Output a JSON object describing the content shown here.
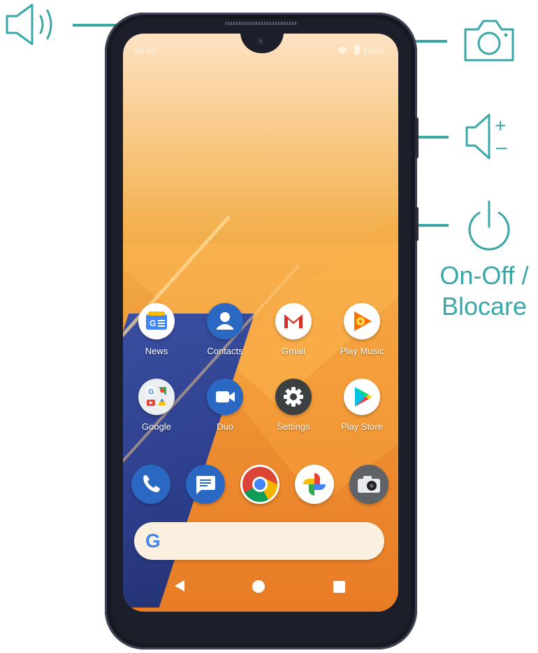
{
  "callouts": {
    "earpiece": {
      "icon": "speaker-icon"
    },
    "front_camera": {
      "icon": "camera-icon"
    },
    "volume": {
      "icon": "volume-icon",
      "plus": "+",
      "minus": "–"
    },
    "power": {
      "icon": "power-icon",
      "label_line1": "On-Off /",
      "label_line2": "Blocare"
    }
  },
  "status_bar": {
    "time": "09:00",
    "battery": "100%",
    "wifi_icon": "wifi-icon",
    "battery_icon": "battery-icon"
  },
  "apps": [
    {
      "label": "News",
      "icon": "google-news-icon",
      "color": "#ffffff"
    },
    {
      "label": "Contacts",
      "icon": "contacts-icon",
      "color": "#2b68c4"
    },
    {
      "label": "Gmail",
      "icon": "gmail-icon",
      "color": "#ffffff"
    },
    {
      "label": "Play Music",
      "icon": "play-music-icon",
      "color": "#ffffff"
    },
    {
      "label": "Google",
      "icon": "google-folder-icon",
      "color": "#ffffff"
    },
    {
      "label": "Duo",
      "icon": "duo-icon",
      "color": "#2b68c4"
    },
    {
      "label": "Settings",
      "icon": "settings-icon",
      "color": "#3c4043"
    },
    {
      "label": "Play Store",
      "icon": "play-store-icon",
      "color": "#ffffff"
    }
  ],
  "dock": [
    {
      "icon": "phone-icon",
      "color": "#2b68c4"
    },
    {
      "icon": "messages-icon",
      "color": "#2b68c4"
    },
    {
      "icon": "chrome-icon",
      "color": "#ffffff"
    },
    {
      "icon": "photos-icon",
      "color": "#ffffff"
    },
    {
      "icon": "camera-app-icon",
      "color": "#5f6368"
    }
  ],
  "search_bar": {
    "logo": "G",
    "icon": "google-g-icon"
  },
  "nav_bar": {
    "back": "back-icon",
    "home": "home-icon",
    "recents": "recents-icon"
  },
  "colors": {
    "accent": "#3aa7a8",
    "phone_body": "#1c1f2a"
  }
}
